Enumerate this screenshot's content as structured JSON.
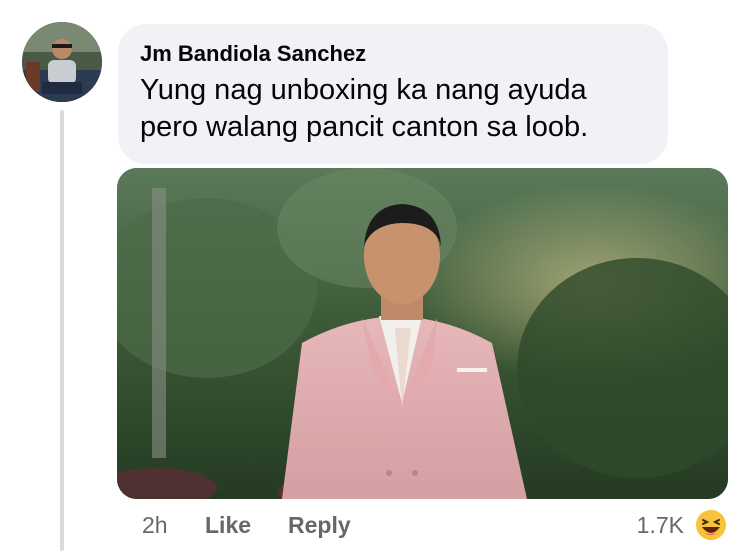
{
  "comment": {
    "author": "Jm Bandiola Sanchez",
    "text": "Yung nag unboxing ka nang ayuda\npero walang pancit canton sa loob."
  },
  "actions": {
    "time": "2h",
    "like_label": "Like",
    "reply_label": "Reply",
    "reaction_count": "1.7K",
    "reaction_icon": "laughing-emoji-icon"
  },
  "colors": {
    "bubble_bg": "#f0f2f5",
    "meta_text": "#65676b",
    "thread_line": "#d7dbe0"
  }
}
